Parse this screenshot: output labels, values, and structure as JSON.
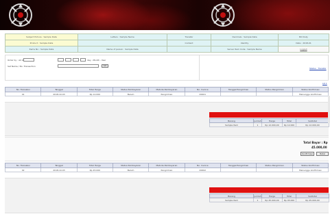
{
  "info_rows": [
    [
      {
        "text": "Subject Picture : Sample Data",
        "color": "y"
      },
      {
        "text": "Letters : Sample Name",
        "color": "c"
      },
      {
        "text": "Transfer",
        "color": "c"
      },
      {
        "text": "Decimals : Sample Data",
        "color": "c"
      },
      {
        "text": "Bill Duty",
        "color": "c"
      }
    ],
    [
      {
        "text": "Product : Sample Data",
        "color": "y"
      },
      {
        "text": "",
        "color": "c"
      },
      {
        "text": "Content",
        "color": "c"
      },
      {
        "text": "Identity",
        "color": "c"
      },
      {
        "text": "Date : 2018-01",
        "color": "c"
      }
    ],
    [
      {
        "text": "Items No : Sample Data",
        "color": "c"
      },
      {
        "text": "Name of person : Sample Data",
        "color": "c"
      },
      {
        "text": "",
        "color": "c"
      },
      {
        "text": "Server Item Code : Sample Name",
        "color": "c"
      },
      {
        "text": "Logout",
        "color": "w",
        "link": true
      }
    ]
  ],
  "filter": {
    "row1_label": "Order by : All Order",
    "row1_hint": "day - Month - Year",
    "row2_label": "Set Name / No. Transaction",
    "go_label": "GO",
    "right_link": "Status : Transfer",
    "right_link2": "LO 1"
  },
  "columns": [
    "No. Transaksi",
    "Tanggal",
    "Total Harga",
    "Status Pembayaran",
    "Metode Pembayaran",
    "No. Invoice",
    "Tanggal Pengiriman",
    "Status Pengiriman",
    "Status Konfirmasi"
  ],
  "orders": [
    {
      "row": [
        "01",
        "2018-10-03",
        "Rp 12.000",
        "Belum",
        "Pengiriman",
        "00001",
        "",
        "",
        "Menunggu konfirmasi"
      ],
      "detail_headers": [
        "Barang",
        "Jumlah",
        "Harga",
        "Total",
        "Subtotal"
      ],
      "detail_row": [
        "Sample Item",
        "1",
        "Rp 12.000,00",
        "Rp 12.000",
        "Rp 12.000,00"
      ]
    },
    {
      "row": [
        "02",
        "2018-10-03",
        "Rp 45.000",
        "Belum",
        "Pengiriman",
        "00002",
        "",
        "",
        "Menunggu konfirmasi"
      ],
      "detail_headers": [
        "Barang",
        "Jumlah",
        "Harga",
        "Total",
        "Subtotal"
      ],
      "detail_row": [
        "Sample Item",
        "1",
        "Rp 45.000,00",
        "Rp 45.000",
        "Rp 45.000,00"
      ]
    }
  ],
  "total": {
    "label": "Total Bayar : Rp",
    "amount": "45.000,00",
    "button1": "Konfirmasi",
    "button2": "Batal"
  }
}
